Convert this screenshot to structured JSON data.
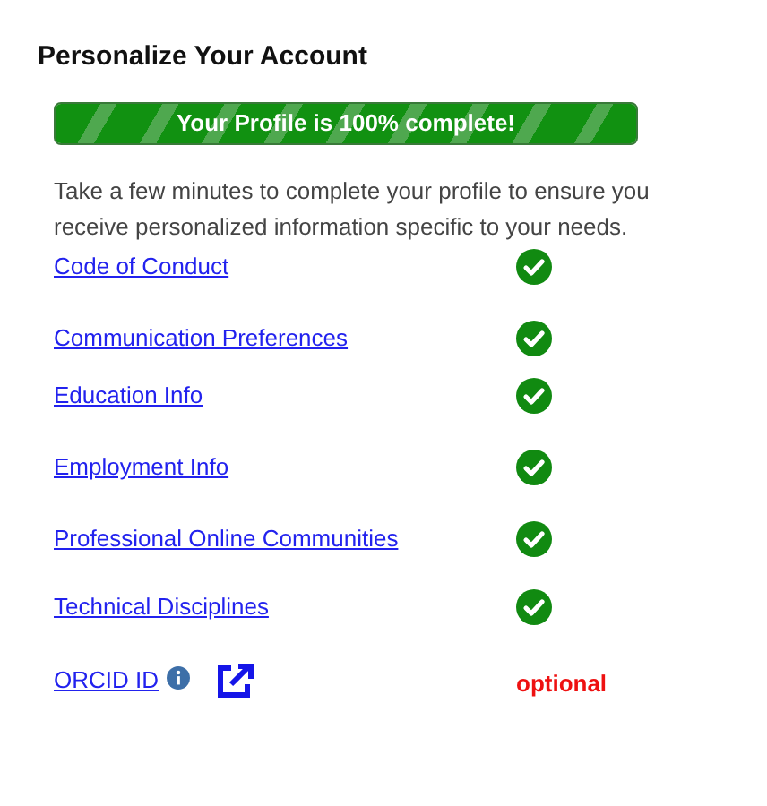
{
  "title": "Personalize Your Account",
  "progress": {
    "label": "Your Profile is 100% complete!",
    "level": 1
  },
  "intro": "Take a few minutes to complete your profile to ensure you receive personalized information specific to your needs.",
  "items": [
    {
      "label": "Code of Conduct",
      "kind": "check",
      "complete": true
    },
    {
      "label": "Communication Preferences",
      "kind": "check",
      "complete": true
    },
    {
      "label": "Education Info",
      "kind": "check",
      "complete": true
    },
    {
      "label": "Employment Info",
      "kind": "check",
      "complete": true
    },
    {
      "label": "Professional Online Communities",
      "kind": "check",
      "complete": true
    },
    {
      "label": "Technical Disciplines",
      "kind": "check",
      "complete": true
    },
    {
      "label": "ORCID ID",
      "kind": "note",
      "note": "optional"
    }
  ]
}
